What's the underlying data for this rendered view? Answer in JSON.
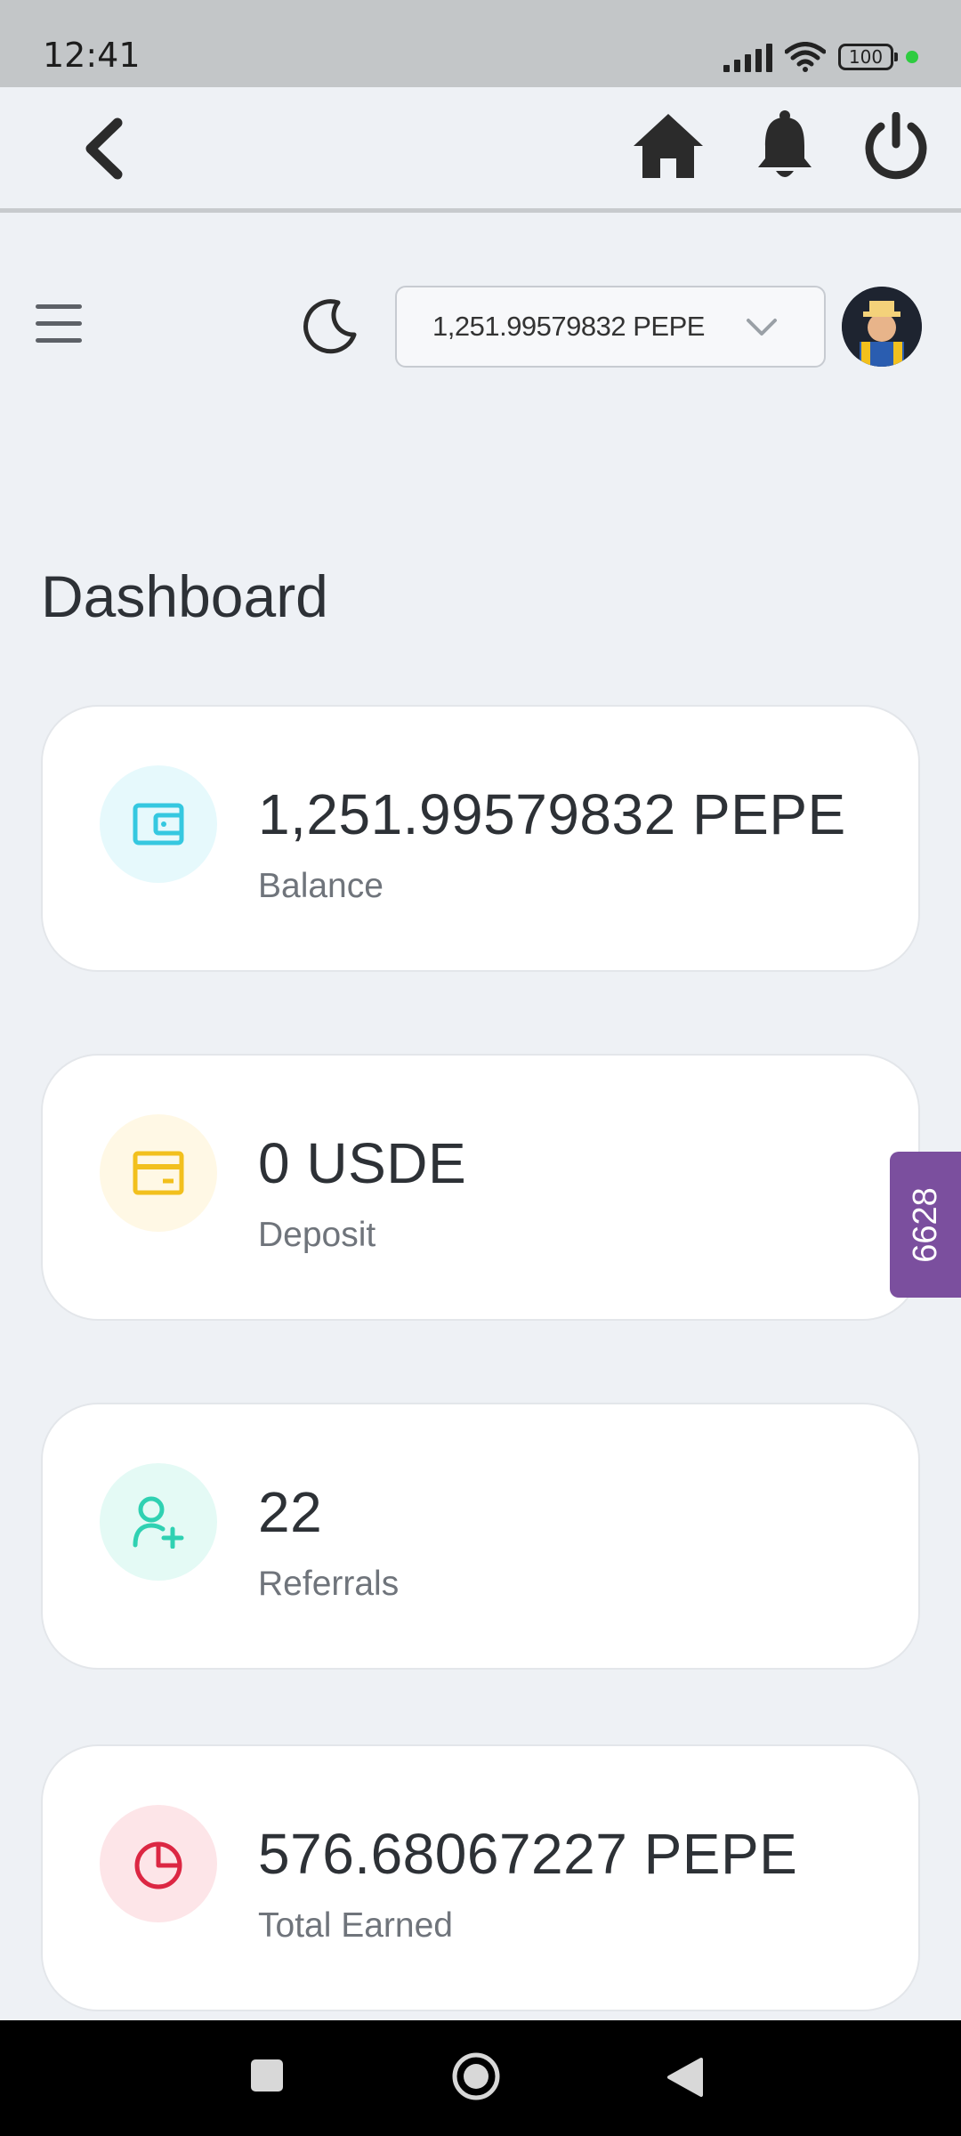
{
  "status_bar": {
    "time": "12:41",
    "battery": "100"
  },
  "app_bar": {
    "icons": [
      "back-arrow-icon",
      "home-icon",
      "bell-icon",
      "power-icon"
    ]
  },
  "header": {
    "currency_selected": "1,251.99579832 PEPE"
  },
  "page_title": "Dashboard",
  "cards": [
    {
      "value": "1,251.99579832 PEPE",
      "label": "Balance",
      "icon": "wallet-icon",
      "icon_color": "#35c8e0",
      "icon_bg": "#e6f9fc"
    },
    {
      "value": "0 USDE",
      "label": "Deposit",
      "icon": "card-icon",
      "icon_color": "#f2c01d",
      "icon_bg": "#fff8e5"
    },
    {
      "value": "22",
      "label": "Referrals",
      "icon": "user-add-icon",
      "icon_color": "#2fd1b2",
      "icon_bg": "#e4faf5"
    },
    {
      "value": "576.68067227 PEPE",
      "label": "Total Earned",
      "icon": "pie-chart-icon",
      "icon_color": "#dc2743",
      "icon_bg": "#fde5e8"
    }
  ],
  "side_tab": {
    "label": "6628",
    "color": "#7b4f9e"
  },
  "system_nav": [
    "recents-button",
    "home-button",
    "back-button"
  ]
}
